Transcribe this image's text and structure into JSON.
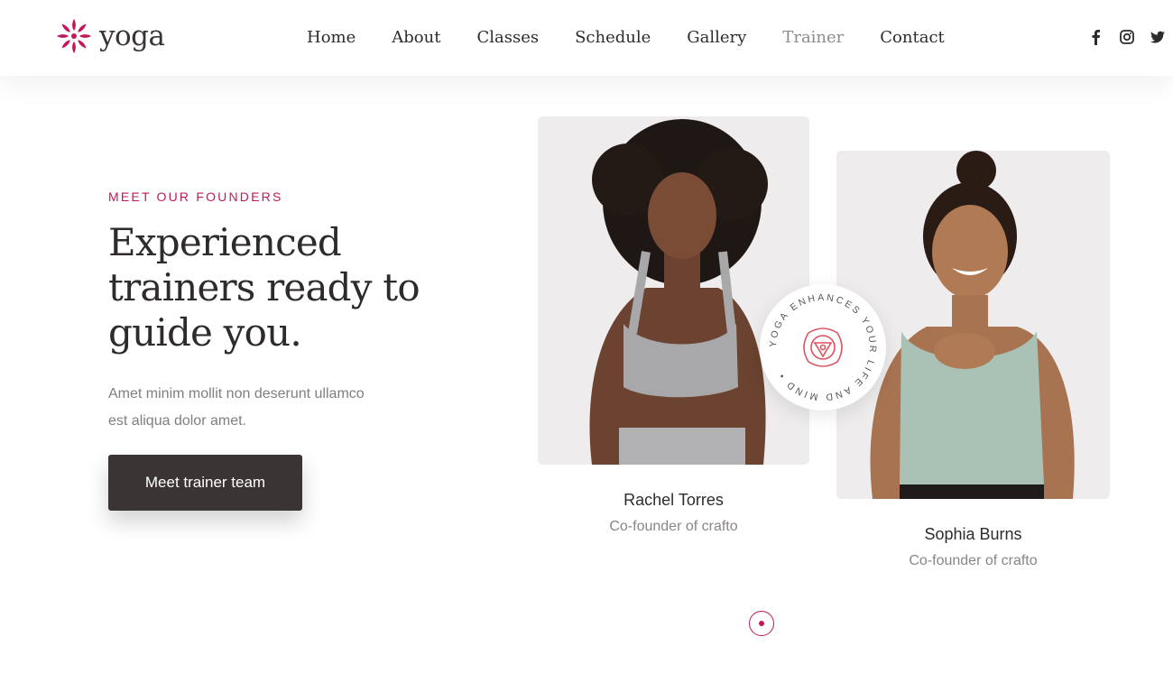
{
  "header": {
    "logo_text": "yoga",
    "nav": [
      {
        "label": "Home"
      },
      {
        "label": "About"
      },
      {
        "label": "Classes"
      },
      {
        "label": "Schedule"
      },
      {
        "label": "Gallery"
      },
      {
        "label": "Trainer"
      },
      {
        "label": "Contact"
      }
    ],
    "social": [
      "facebook-icon",
      "instagram-icon",
      "twitter-icon"
    ]
  },
  "hero": {
    "eyebrow": "MEET OUR FOUNDERS",
    "headline": "Experienced trainers ready to guide you.",
    "description": "Amet minim mollit non deserunt ullamco est aliqua dolor amet.",
    "cta_label": "Meet trainer team"
  },
  "trainers": [
    {
      "name": "Rachel Torres",
      "role": "Co-founder of crafto"
    },
    {
      "name": "Sophia Burns",
      "role": "Co-founder of crafto"
    }
  ],
  "badge": {
    "circle_text": "YOGA ENHANCES YOUR LIFE AND MIND •"
  },
  "colors": {
    "accent": "#c2185b",
    "dark": "#3a3434"
  }
}
